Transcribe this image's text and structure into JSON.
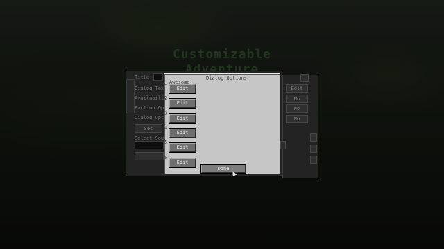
{
  "background": {
    "title": "Customizable Adventure"
  },
  "back_screen": {
    "labels": [
      "Title",
      "Dialog Text",
      "Availability O",
      "Faction Optio",
      "Dialog Optio",
      "Select Sound"
    ],
    "right_buttons": [
      "Edit",
      "No",
      "No",
      "No"
    ],
    "set_label": "Set"
  },
  "dialog": {
    "title": "Dialog Options",
    "options": [
      {
        "number": "1",
        "name": "Awesome",
        "edit_label": "Edit"
      },
      {
        "number": "2",
        "name": "",
        "edit_label": "Edit"
      },
      {
        "number": "3",
        "name": "",
        "edit_label": "Edit"
      },
      {
        "number": "4",
        "name": "",
        "edit_label": "Edit"
      },
      {
        "number": "5",
        "name": "",
        "edit_label": "Edit"
      },
      {
        "number": "6",
        "name": "",
        "edit_label": "Edit"
      }
    ],
    "done_label": "Done"
  },
  "colors": {
    "dialog_bg": "#c6c6c6",
    "button_bg": "#6f6f6f",
    "button_text": "#e8e8e8"
  },
  "icons": {
    "cursor": "mouse-pointer-icon"
  }
}
